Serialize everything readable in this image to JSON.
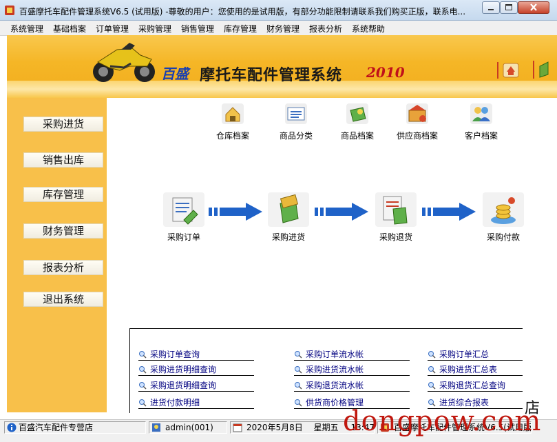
{
  "window": {
    "title": "百盛摩托车配件管理系统V6.5 (试用版) -尊敬的用户：您使用的是试用版，有部分功能限制请联系我们购买正版，联系电..."
  },
  "menu": [
    "系统管理",
    "基础档案",
    "订单管理",
    "采购管理",
    "销售管理",
    "库存管理",
    "财务管理",
    "报表分析",
    "系统帮助"
  ],
  "banner": {
    "brand": "百盛",
    "title": "摩托车配件管理系统",
    "year": "2010"
  },
  "sidebar": [
    "采购进货",
    "销售出库",
    "库存管理",
    "财务管理",
    "报表分析",
    "退出系统"
  ],
  "top_icons": [
    {
      "label": "仓库档案",
      "icon": "warehouse-icon"
    },
    {
      "label": "商品分类",
      "icon": "category-icon"
    },
    {
      "label": "商品档案",
      "icon": "product-icon"
    },
    {
      "label": "供应商档案",
      "icon": "supplier-icon"
    },
    {
      "label": "客户档案",
      "icon": "customer-icon"
    }
  ],
  "flow": [
    {
      "label": "采购订单",
      "icon": "purchase-order-icon"
    },
    {
      "label": "采购进货",
      "icon": "purchase-in-icon"
    },
    {
      "label": "采购退货",
      "icon": "purchase-return-icon"
    },
    {
      "label": "采购付款",
      "icon": "purchase-payment-icon"
    }
  ],
  "links": {
    "col1": [
      "采购订单查询",
      "采购进货明细查询",
      "采购退货明细查询",
      "进货付款明细"
    ],
    "col2": [
      "采购订单流水帐",
      "采购进货流水帐",
      "采购退货流水帐",
      "供货商价格管理"
    ],
    "col3": [
      "采购订单汇总",
      "采购进货汇总表",
      "采购退货汇总查询",
      "进货综合报表"
    ]
  },
  "status": {
    "shop": "百盛汽车配件专营店",
    "user": "admin(001)",
    "date": "2020年5月8日",
    "weekday": "星期五",
    "time": "13:47",
    "app": "百盛摩托车配件管理系统V6.5(试用版)"
  },
  "watermark": {
    "text": "dongpow.com",
    "suffix": "店"
  },
  "colors": {
    "banner": "#f5b626",
    "sidebar": "#f8c04a",
    "arrow": "#1f62c8",
    "link": "#000080"
  }
}
